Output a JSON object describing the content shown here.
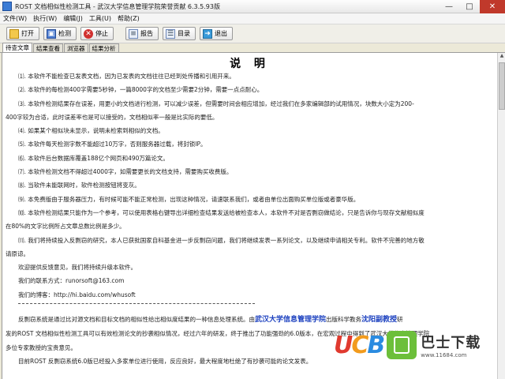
{
  "window": {
    "title": "ROST 文档相似性检测工具 - 武汉大学信息管理学院荣誉贡献 6.3.5.93版",
    "minimize": "—",
    "maximize": "□",
    "close": "✕"
  },
  "menu": [
    "文件(W)",
    "执行(W)",
    "编辑(J)",
    "工具(U)",
    "帮助(Z)"
  ],
  "toolbar": {
    "open": "打开",
    "detect": "检测",
    "stop": "停止",
    "report": "报告",
    "toc": "目录",
    "exit": "退出"
  },
  "tabs": [
    "待查文章",
    "结果查看",
    "浏览器",
    "结果分析"
  ],
  "doc": {
    "title": "说 明",
    "p1": "⑴. 本软件不能检查已发表文档，因为已发表的文档往往已经到处传播和引用开来。",
    "p2": "⑵. 本软件的每检测400字需要5秒钟，一篇8000字的文档至少需要2分钟，需要一点点耐心。",
    "p3a": "⑶. 本软件检测结果存在误差，用更小的文档进行检测，可以减少误差，但需要时间会相应增加，经过我们在多家编辑部的试用情况，块数大小定为200-",
    "p3b": "400字较为合适，此时误差率也是可以接受的，文档相似率一般是比实际的要低。",
    "p4": "⑷. 如果某个相似块未显示，说明未检索到相似的文档。",
    "p5": "⑸. 本软件每天检测字数不能超过10万字，否则服务器过载，将封锁IP。",
    "p6": "⑹. 本软件后台数据库覆盖188亿个网页和490万篇论文。",
    "p7": "⑺. 本软件检测文档不得超过4000字，如需要更长的文档支持，需要购买收费版。",
    "p8": "⑻. 当软件未能联网时，软件检测按钮将变灰。",
    "p9": "⑼. 本免费版由于服务器压力，有时候可能不能正常检测，出现这种情况，请速联系我们，或者由单位出面购买单位版或者豪华版。",
    "p10a": "⑽. 本软件检测结果只能作为一个参考，可以使用表格右键导出详细检查结果发送给被检查本人，本软件不对是否剽窃做结论，只是告诉你与现存文献相似度",
    "p10b": "在80%的文字比例所占文章总数比例是多少。",
    "p11a": "⑾. 我们将持续投入反剽窃的研究，本人已获批国家自科基金进一步反剽窃问题，我们将继续发表一系列论文，以及继续申请相关专利。软件不完善的地方敬",
    "p11b": "请原谅。",
    "feedback": "欢迎提供反馈意见，我们将持续升级本软件。",
    "email": "我们的联系方式：runorsoft@163.com",
    "blog": "我们的博客：http://hi.baidu.com/whusoft",
    "about1_pre": "反剽窃系统是通过比对源文档和目标文档的相似性给出相似度结果的一种信息处理系统。由",
    "about1_univ": "武汉大学信息管理学院",
    "about1_mid": "出版科学教务",
    "about1_prof": "沈阳副教授",
    "about1_post": "研",
    "about2": "发的ROST 文档相似性检测工具可以有效检测论文的抄袭相似情况，经过六年的研发，终于推出了功能强劲的6.0版本，在宏观过程中得到了武汉大学信息管理学院",
    "about3": "多位专家教授的宝贵意见。",
    "about4": "目前ROST 反剽窃系统6.0版已经投入多家单位进行使用，反应良好，最大程度地杜绝了有抄袭可能的论文发表。"
  },
  "watermark": {
    "ucb": [
      "U",
      "C",
      "B"
    ],
    "brand": "巴士下载",
    "url": "www.11684.com"
  }
}
